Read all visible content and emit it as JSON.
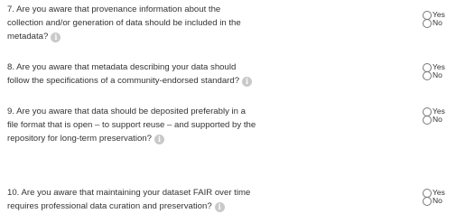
{
  "questions": [
    {
      "lines": [
        "7. Are you aware that provenance information about the",
        "collection and/or generation of data should be included in the",
        "metadata?"
      ],
      "options": [
        "Yes",
        "No"
      ]
    },
    {
      "lines": [
        "8. Are you aware that metadata describing your data should",
        "follow the specifications of a community-endorsed standard?"
      ],
      "options": [
        "Yes",
        "No"
      ]
    },
    {
      "lines": [
        "9. Are you aware that data should be deposited preferably in a",
        "file format that is open – to support reuse – and supported by the",
        "repository for long-term preservation?"
      ],
      "options": [
        "Yes",
        "No"
      ]
    },
    {
      "lines": [
        "10. Are you aware that maintaining your dataset FAIR over time",
        "requires professional data curation and preservation?"
      ],
      "options": [
        "Yes",
        "No"
      ]
    }
  ],
  "info_icon": {
    "icon": "info-icon",
    "glyph": "i",
    "color": "#c9c9c9"
  }
}
